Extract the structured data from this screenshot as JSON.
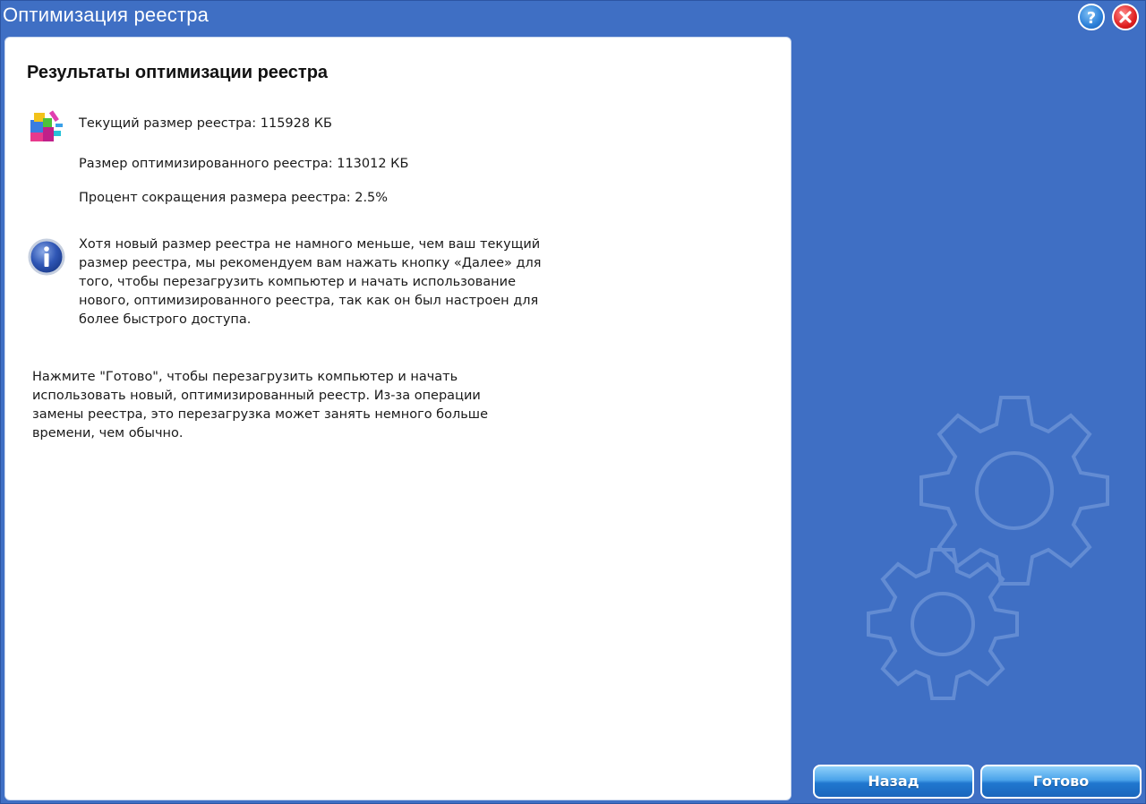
{
  "window": {
    "title": "Оптимизация реестра"
  },
  "titlebar": {
    "help_icon": "question-mark",
    "close_icon": "x-mark"
  },
  "content": {
    "heading": "Результаты оптимизации реестра",
    "current_size": "Текущий размер реестра: 115928 КБ",
    "optimized_size": "Размер оптимизированного реестра: 113012 КБ",
    "reduction_percent": "Процент сокращения размера реестра: 2.5%",
    "info_lines": [
      "Хотя новый размер реестра не намного меньше, чем ваш текущий",
      "размер реестра, мы рекомендуем вам нажать кнопку «Далее» для",
      "того, чтобы перезагрузить компьютер и начать использование",
      "нового, оптимизированного реестра, так как он был настроен для",
      "более быстрого доступа."
    ],
    "finish_lines": [
      "Нажмите \"Готово\", чтобы перезагрузить компьютер и начать",
      "использовать новый, оптимизированный реестр. Из-за операции",
      "замены реестра, это перезагрузка может занять немного больше",
      "времени, чем обычно."
    ]
  },
  "buttons": {
    "back": "Назад",
    "done": "Готово"
  },
  "colors": {
    "background": "#3f6fc4",
    "panel": "#ffffff",
    "button_blue": "#2077cf",
    "close_red": "#e02020"
  }
}
